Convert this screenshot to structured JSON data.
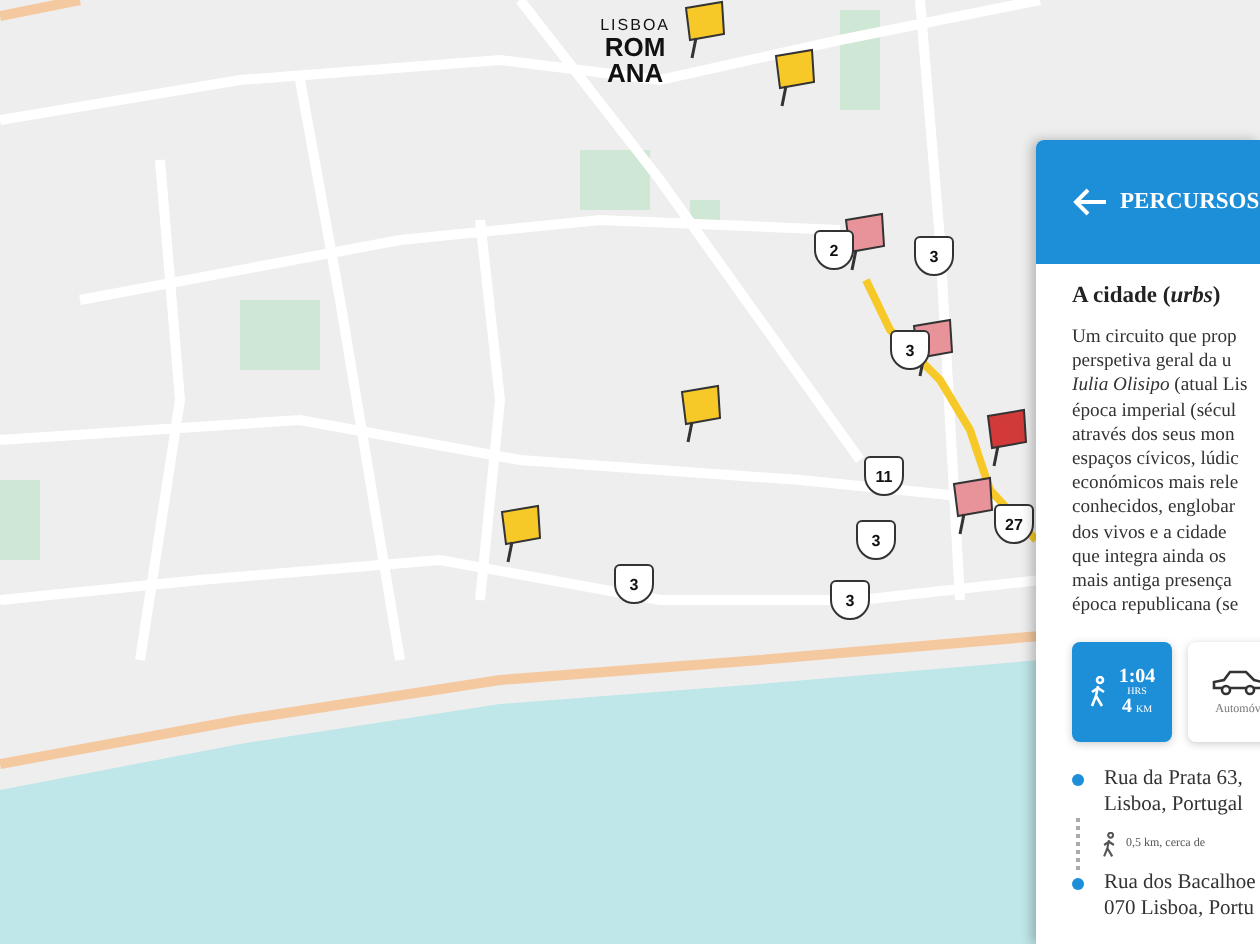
{
  "map": {
    "logo": {
      "line_1": "LISBOA",
      "line_2": "ROMANA"
    },
    "markers": [
      {
        "kind": "flag",
        "color": "#f7c928"
      },
      {
        "kind": "flag",
        "color": "#f7c928"
      },
      {
        "kind": "flag",
        "color": "#f7c928"
      },
      {
        "kind": "flag",
        "color": "#f7c928"
      },
      {
        "kind": "flag",
        "color": "#e8939a"
      },
      {
        "kind": "flag",
        "color": "#e8939a"
      },
      {
        "kind": "flag",
        "color": "#d23a3a"
      },
      {
        "kind": "flag",
        "color": "#e8939a"
      },
      {
        "kind": "cluster",
        "count": "2"
      },
      {
        "kind": "cluster",
        "count": "3"
      },
      {
        "kind": "cluster",
        "count": "3"
      },
      {
        "kind": "cluster",
        "count": "11"
      },
      {
        "kind": "cluster",
        "count": "3"
      },
      {
        "kind": "cluster",
        "count": "3"
      },
      {
        "kind": "cluster",
        "count": "3"
      },
      {
        "kind": "cluster",
        "count": "27"
      }
    ]
  },
  "panel": {
    "back_label": "PERCURSOS",
    "title": "A cidade (*urbs*)",
    "description_lines": [
      "Um circuito que prop",
      "perspetiva geral da u",
      "*Iulia Olisipo* (atual Lis",
      "época imperial (sécul",
      "através dos seus mon",
      "espaços cívicos, lúdic",
      "económicos mais rele",
      "conhecidos, englobar",
      "dos vivos e a cidade",
      "que integra ainda os",
      "mais antiga presença",
      "época republicana (se"
    ],
    "modes": [
      {
        "kind": "walk",
        "selected": true,
        "time": "1:04",
        "time_unit": "HRS",
        "distance": "4",
        "distance_unit": "KM"
      },
      {
        "kind": "car",
        "selected": false,
        "label": "Automóv"
      }
    ],
    "route": [
      {
        "kind": "stop",
        "lines": [
          "Rua da Prata 63,",
          "Lisboa, Portugal"
        ]
      },
      {
        "kind": "leg",
        "text": "0,5 km, cerca de"
      },
      {
        "kind": "stop",
        "lines": [
          "Rua dos Bacalhoe",
          "070 Lisboa, Portu"
        ]
      }
    ]
  }
}
